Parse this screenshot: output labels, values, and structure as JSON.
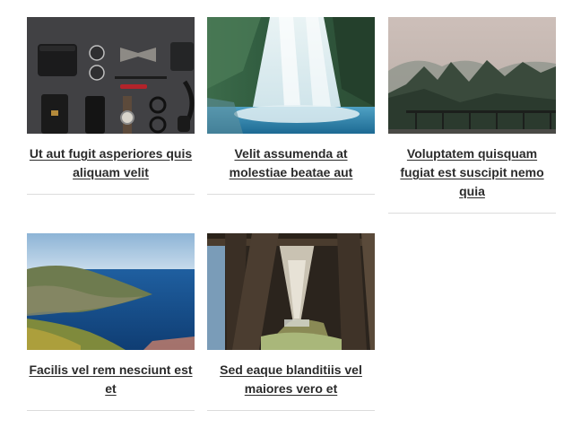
{
  "posts": [
    {
      "title": "Ut aut fugit asperiores quis aliquam velit",
      "image": "flatlay-accessories-photo"
    },
    {
      "title": "Velit assumenda at molestiae beatae aut",
      "image": "waterfall-photo"
    },
    {
      "title": "Voluptatem quisquam fugiat est suscipit nemo quia",
      "image": "foggy-forest-bridge-photo"
    },
    {
      "title": "Facilis vel rem nesciunt est et",
      "image": "coastal-cliffs-sea-photo"
    },
    {
      "title": "Sed eaque blanditiis vel maiores vero et",
      "image": "pier-underside-photo"
    }
  ]
}
